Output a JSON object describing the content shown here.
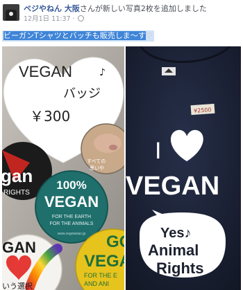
{
  "post": {
    "author": "ベジやねん 大阪",
    "action_text": "さんが新しい写真2枚を追加しました",
    "date": "12月1日 11:37",
    "audience_icon": "globe-icon",
    "caption_highlight": "ビーガンTシャツとバッチも販売しま～す",
    "caption_emoji": "♡"
  },
  "photo_left": {
    "sign_line1": "VEGAN",
    "sign_note": "♪",
    "sign_line2": "バッジ",
    "sign_price": "￥300",
    "badge_top_left": "gan",
    "badge_top_left_sub": "RIGHTS",
    "badge_center_title": "100%",
    "badge_center_word": "VEGAN",
    "badge_center_sub1": "FOR THE EARTH",
    "badge_center_sub2": "FOR THE ANIMALS",
    "badge_center_url": "www.vegetarian.jp",
    "badge_bottom_left_word": "GAN",
    "badge_bottom_left_sub": "いう選択",
    "badge_bottom_right_word": "GO",
    "badge_bottom_right_word2": "VEGAN",
    "badge_bottom_right_sub1": "FOR THE E",
    "badge_bottom_right_sub2": "AND ANI",
    "badge_pig_text1": "すべての",
    "badge_pig_text2": "思いや"
  },
  "photo_right": {
    "price_tag": "¥2500",
    "shirt_line1": "I",
    "shirt_line2": "VEGAN",
    "bubble_line1": "Yes♪",
    "bubble_line2": "Animal",
    "bubble_line3": "Rights"
  },
  "colors": {
    "link": "#365899",
    "caption_bg": "#cfe3f7",
    "caption_highlight_bg": "#3f85d8",
    "shirt": "#1c2130",
    "badge_teal": "#1f6f6c",
    "badge_yellow": "#e7c31d",
    "badge_red": "#c0261f"
  }
}
